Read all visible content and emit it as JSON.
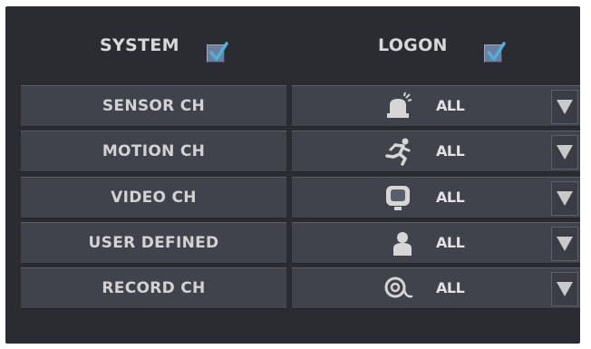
{
  "header": {
    "system_label": "SYSTEM",
    "system_checked": true,
    "logon_label": "LOGON",
    "logon_checked": true
  },
  "rows": [
    {
      "label": "SENSOR CH",
      "icon": "alarm-bell-icon",
      "value": "ALL"
    },
    {
      "label": "MOTION CH",
      "icon": "running-man-icon",
      "value": "ALL"
    },
    {
      "label": "VIDEO CH",
      "icon": "monitor-icon",
      "value": "ALL"
    },
    {
      "label": "USER DEFINED",
      "icon": "user-icon",
      "value": "ALL"
    },
    {
      "label": "RECORD CH",
      "icon": "record-icon",
      "value": "ALL"
    }
  ],
  "colors": {
    "panel_bg": "#2a2c31",
    "row_bg": "#40434c",
    "text": "#d2d2d4",
    "checkbox": "#6c7fa0"
  }
}
